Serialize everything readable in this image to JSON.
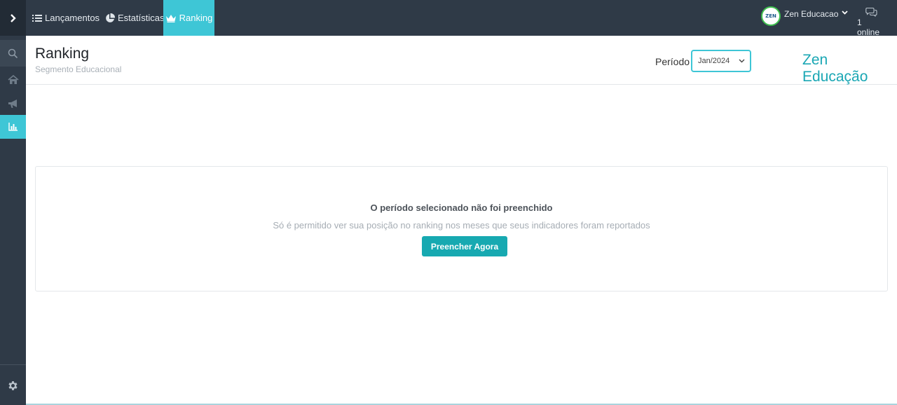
{
  "topnav": {
    "items": [
      {
        "label": "Lançamentos",
        "icon": "list-icon"
      },
      {
        "label": "Estatísticas",
        "icon": "pie-chart-icon"
      },
      {
        "label": "Ranking",
        "icon": "crown-icon",
        "active": true
      }
    ],
    "user": {
      "avatar_text": "ZEN",
      "name": "Zen Educacao"
    },
    "online": {
      "label": "1 online",
      "icon": "chat-icon"
    }
  },
  "sidebar": {
    "items": [
      {
        "name": "toggle",
        "icon": "chevron-right-icon"
      },
      {
        "name": "search",
        "icon": "search-icon"
      },
      {
        "name": "home",
        "icon": "home-icon"
      },
      {
        "name": "announcements",
        "icon": "megaphone-icon"
      },
      {
        "name": "ranking",
        "icon": "bar-chart-icon",
        "active": true
      },
      {
        "name": "settings",
        "icon": "gear-icon"
      }
    ]
  },
  "header": {
    "title": "Ranking",
    "subtitle": "Segmento Educacional",
    "period_label": "Período",
    "period_value": "Jan/2024",
    "brand": "Zen Educação"
  },
  "notice": {
    "title": "O período selecionado não foi preenchido",
    "message": "Só é permitido ver sua posição no ranking nos meses que seus indicadores foram reportados",
    "button_label": "Preencher Agora"
  },
  "colors": {
    "accent": "#3ec6d6",
    "brand": "#1aa7b4",
    "button": "#17a9b1",
    "nav_bg": "#2f3a47"
  }
}
